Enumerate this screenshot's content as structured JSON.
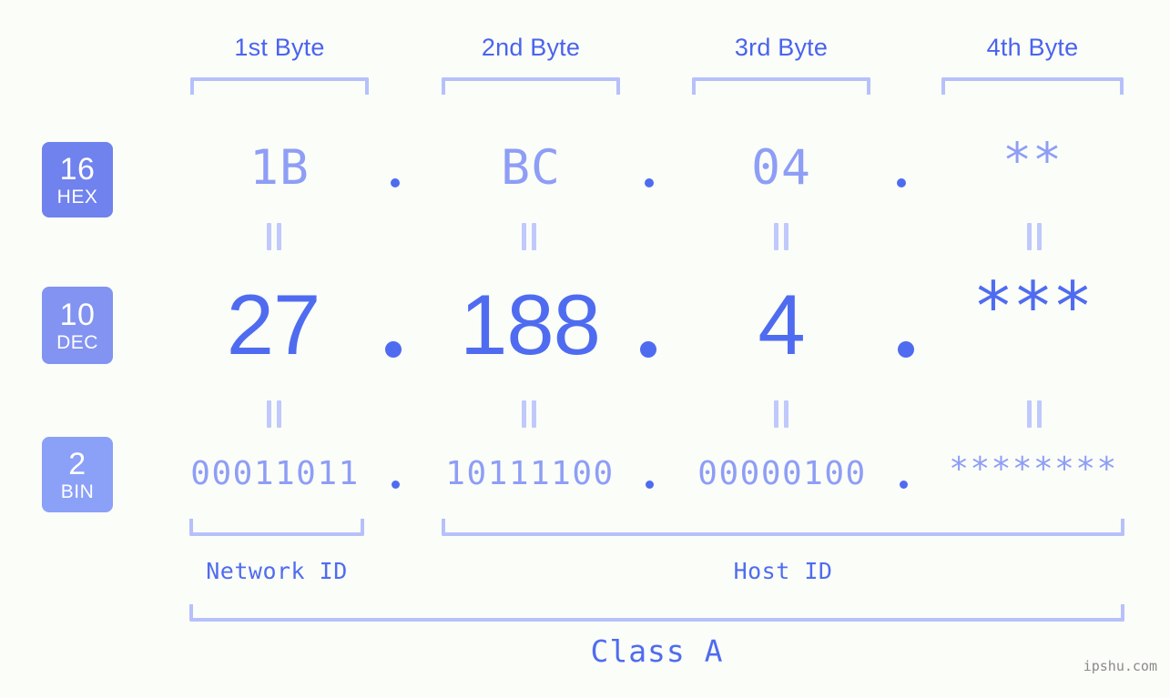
{
  "meta": {
    "background_color": "#fbfdf8",
    "accent_color": "#4f6cf0",
    "muted_accent_color": "#8e9ef6",
    "bracket_color": "#b6c1fb",
    "badge_hex_color": "#7082ed",
    "badge_dec_color": "#8293f1",
    "badge_bin_color": "#8ba0f7"
  },
  "byte_headers": [
    {
      "label": "1st Byte"
    },
    {
      "label": "2nd Byte"
    },
    {
      "label": "3rd Byte"
    },
    {
      "label": "4th Byte"
    }
  ],
  "rows": [
    {
      "badge_number": "16",
      "badge_name": "HEX",
      "values": [
        "1B",
        "BC",
        "04",
        "**"
      ],
      "separator": "."
    },
    {
      "badge_number": "10",
      "badge_name": "DEC",
      "values": [
        "27",
        "188",
        "4",
        "***"
      ],
      "separator": "."
    },
    {
      "badge_number": "2",
      "badge_name": "BIN",
      "values": [
        "00011011",
        "10111100",
        "00000100",
        "********"
      ],
      "separator": "."
    }
  ],
  "equals_symbol": "=",
  "id_sections": [
    {
      "label": "Network ID"
    },
    {
      "label": "Host ID"
    }
  ],
  "class_label": "Class A",
  "watermark": "ipshu.com"
}
